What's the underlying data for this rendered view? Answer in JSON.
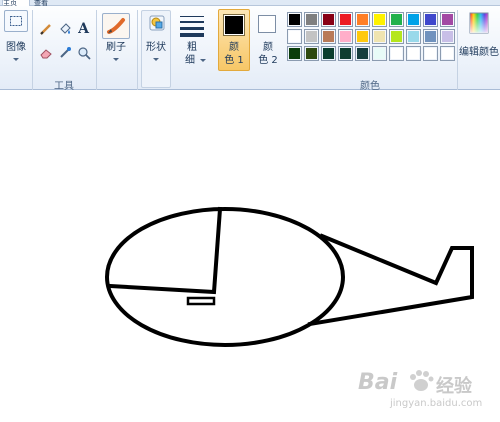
{
  "tabs": [
    {
      "label": "主页",
      "active": true
    },
    {
      "label": "查看",
      "active": false
    }
  ],
  "ribbon": {
    "image": {
      "label": "图像",
      "icon": "select-rect-icon"
    },
    "tools": {
      "label": "工具",
      "items": [
        "pencil-icon",
        "fill-bucket-icon",
        "text-icon",
        "eraser-icon",
        "color-picker-icon",
        "magnifier-icon"
      ],
      "text_tool_glyph": "A"
    },
    "brushes": {
      "label": "刷子",
      "icon": "brush-icon"
    },
    "shapes": {
      "label": "形状",
      "icon": "shapes-icon"
    },
    "size": {
      "label_line1": "粗",
      "label_line2": "细"
    },
    "color1": {
      "line1": "颜",
      "line2": "色 1",
      "color": "#000000"
    },
    "color2": {
      "line1": "颜",
      "line2": "色 2",
      "color": "#ffffff"
    },
    "colors_label": "颜色",
    "edit_colors": {
      "label": "编辑颜色",
      "icon": "color-wheel-icon"
    },
    "palette_row1": [
      "#000000",
      "#7f7f7f",
      "#880015",
      "#ed1c24",
      "#ff7f27",
      "#fff200",
      "#22b14c",
      "#00a2e8",
      "#3f48cc",
      "#a349a4"
    ],
    "palette_row2": [
      "#ffffff",
      "#c3c3c3",
      "#b97a57",
      "#ffaec9",
      "#ffc90e",
      "#efe4b0",
      "#b5e61d",
      "#99d9ea",
      "#7092be",
      "#c8bfe7"
    ],
    "palette_row3": [
      "#0b3d0b",
      "#2f4a10",
      "#0b3d2d",
      "#0f3d30",
      "#153d3d",
      "#e8fbf8",
      "#ffffff",
      "#ffffff",
      "#ffffff",
      "#ffffff"
    ]
  },
  "watermark": {
    "brand": "Bai",
    "brand2": "经验",
    "url": "jingyan.baidu.com"
  }
}
